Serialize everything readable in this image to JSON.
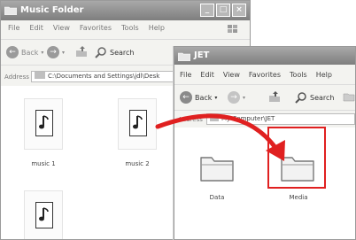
{
  "window1": {
    "title": "Music Folder",
    "menu": [
      "File",
      "Edit",
      "View",
      "Favorites",
      "Tools",
      "Help"
    ],
    "back_label": "Back",
    "search_label": "Search",
    "address_label": "Address",
    "address_value": "C:\\Documents and Settings\\jdl\\Desk",
    "files": [
      {
        "label": "music 1"
      },
      {
        "label": "music 2"
      },
      {
        "label": ""
      }
    ]
  },
  "window2": {
    "title": "JET",
    "menu": [
      "File",
      "Edit",
      "View",
      "Favorites",
      "Tools",
      "Help"
    ],
    "back_label": "Back",
    "search_label": "Search",
    "address_label": "Address",
    "address_value": "My Computer\\JET",
    "folders": [
      {
        "label": "Data"
      },
      {
        "label": "Media"
      }
    ]
  },
  "annotation": {
    "arrow_color": "#e02020",
    "highlight_color": "#e02020"
  },
  "icons": {
    "window_buttons": [
      "minimize-icon",
      "maximize-icon",
      "close-icon"
    ]
  }
}
